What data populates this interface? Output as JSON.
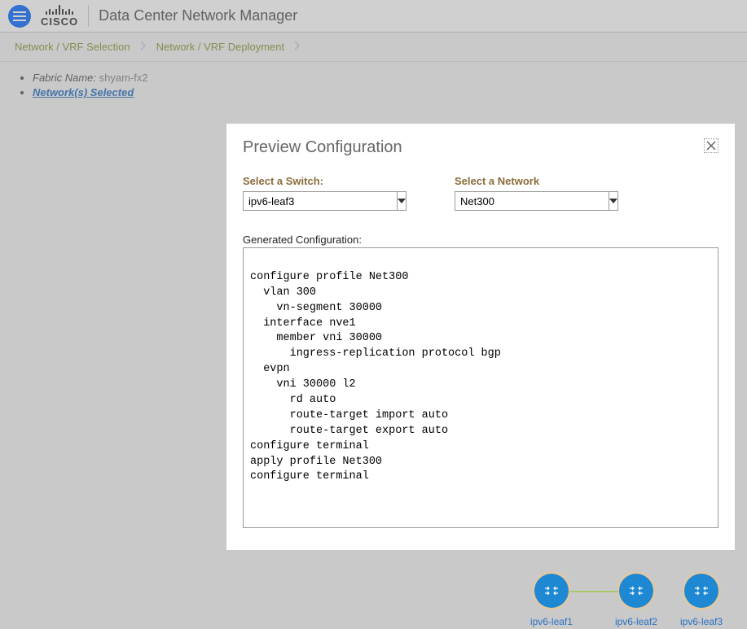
{
  "header": {
    "app_title": "Data Center Network Manager"
  },
  "breadcrumb": {
    "item0": "Network / VRF Selection",
    "item1": "Network / VRF Deployment"
  },
  "info": {
    "fabric_label": "Fabric Name: ",
    "fabric_value": "shyam-fx2",
    "networks_selected": "Network(s) Selected"
  },
  "modal": {
    "title": "Preview Configuration",
    "select_switch_label": "Select a Switch:",
    "select_switch_value": "ipv6-leaf3",
    "select_network_label": "Select a Network",
    "select_network_value": "Net300",
    "generated_label": "Generated Configuration:",
    "generated_config": "\nconfigure profile Net300\n  vlan 300\n    vn-segment 30000\n  interface nve1\n    member vni 30000\n      ingress-replication protocol bgp\n  evpn\n    vni 30000 l2\n      rd auto\n      route-target import auto\n      route-target export auto\nconfigure terminal\napply profile Net300\nconfigure terminal"
  },
  "topology": {
    "node0": "ipv6-leaf1",
    "node1": "ipv6-leaf2",
    "node2": "ipv6-leaf3"
  }
}
